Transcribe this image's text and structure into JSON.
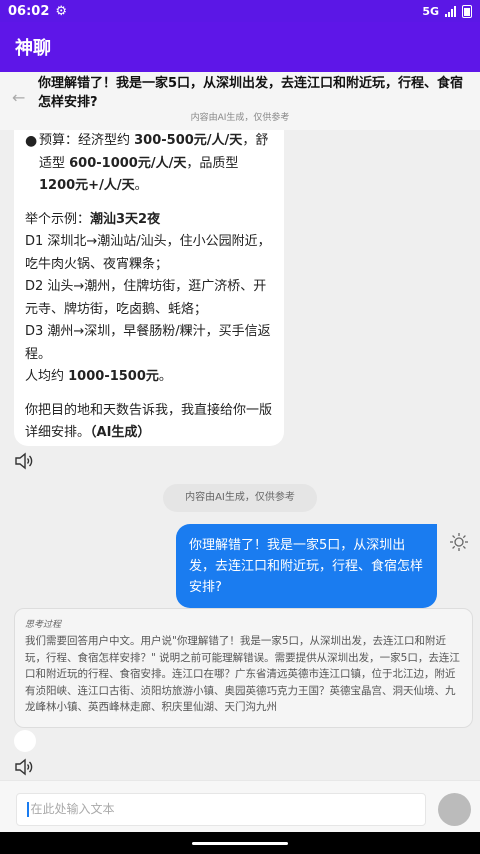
{
  "status_bar": {
    "time": "06:02",
    "network": "5G"
  },
  "app_bar": {
    "title": "神聊"
  },
  "top_message": {
    "question": "你理解错了！我是一家5口，从深圳出发，去连江口和附近玩，行程、食宿怎样安排?",
    "note": "内容由AI生成，仅供参考"
  },
  "ai_response": {
    "budget_line1": "预算：经济型约 ",
    "budget_bold1": "300-500元/人/天",
    "budget_line2": "，舒适型 ",
    "budget_bold2": "600-1000元/人/天",
    "budget_line3": "，品质型 ",
    "budget_bold3": "1200元+/人/天",
    "budget_end": "。",
    "example_prefix": "举个示例：",
    "example_title": "潮汕3天2夜",
    "d1": "D1 深圳北→潮汕站/汕头，住小公园附近，吃牛肉火锅、夜宵粿条；",
    "d2": "D2 汕头→潮州，住牌坊街，逛广济桥、开元寺、牌坊街，吃卤鹅、蚝烙；",
    "d3": "D3 潮州→深圳，早餐肠粉/粿汁，买手信返程。",
    "per_person_prefix": "人均约 ",
    "per_person_bold": "1000-1500元",
    "per_person_end": "。",
    "closing_text": "你把目的地和天数告诉我，我直接给你一版详细安排。",
    "closing_tag": "（AI生成）"
  },
  "disclaimer": "内容由AI生成，仅供参考",
  "user_message": "你理解错了！我是一家5口，从深圳出发，去连江口和附近玩，行程、食宿怎样安排?",
  "thinking": {
    "title": "思考过程",
    "text": "我们需要回答用户中文。用户说\"你理解错了！我是一家5口，从深圳出发，去连江口和附近玩，行程、食宿怎样安排？\" 说明之前可能理解错误。需要提供从深圳出发，一家5口，去连江口和附近玩的行程、食宿安排。连江口在哪？广东省清远英德市连江口镇，位于北江边，附近有浈阳峡、连江口古街、浈阳坊旅游小镇、奥园英德巧克力王国？英德宝晶宫、洞天仙境、九龙峰林小镇、英西峰林走廊、积庆里仙湖、天门沟九州"
  },
  "input": {
    "placeholder": "在此处输入文本"
  },
  "colors": {
    "app_bar": "#5e16e8",
    "user_bubble": "#1a7cf0",
    "background": "#efefef"
  },
  "icons": {
    "status_settings": "gear-icon",
    "back": "arrow-left-icon",
    "speaker": "speaker-icon",
    "user_action": "sun-icon",
    "send": "send-button"
  }
}
